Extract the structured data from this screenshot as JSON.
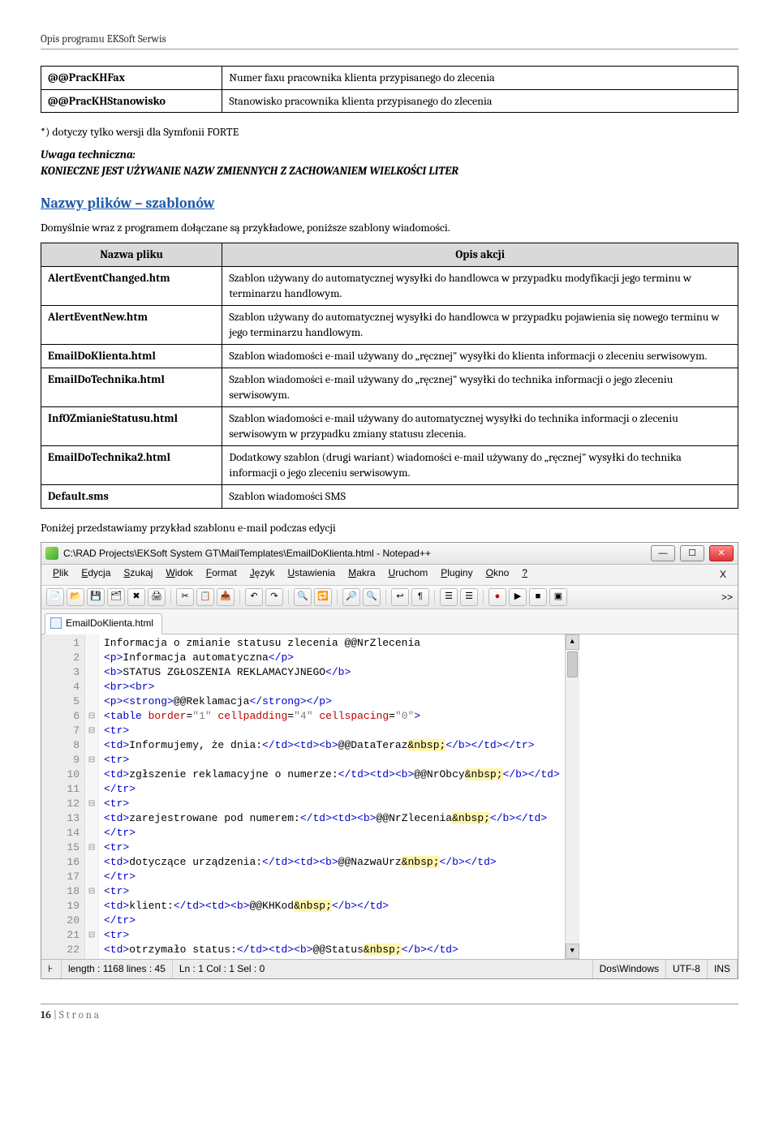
{
  "header": "Opis programu EKSoft Serwis",
  "footer_page": "16",
  "footer_label": " | S t r o n a",
  "table1": {
    "rows": [
      {
        "key": "@@PracKHFax",
        "val": "Numer faxu pracownika klienta przypisanego do zlecenia"
      },
      {
        "key": "@@PracKHStanowisko",
        "val": "Stanowisko pracownika klienta przypisanego do zlecenia"
      }
    ]
  },
  "note1": "*) dotyczy tylko wersji dla Symfonii FORTE",
  "uwaga_label": "Uwaga techniczna:",
  "uwaga_text": "KONIECZNE JEST UŻYWANIE NAZW ZMIENNYCH Z ZACHOWANIEM WIELKOŚCI LITER",
  "section_title": "Nazwy plików – szablonów",
  "intro2": "Domyślnie wraz z programem dołączane są przykładowe, poniższe szablony wiadomości.",
  "table2": {
    "header": [
      "Nazwa pliku",
      "Opis akcji"
    ],
    "rows": [
      {
        "key": "AlertEventChanged.htm",
        "val": "Szablon używany do automatycznej wysyłki do handlowca w przypadku modyfikacji jego terminu w terminarzu handlowym."
      },
      {
        "key": "AlertEventNew.htm",
        "val": "Szablon używany do automatycznej wysyłki do handlowca w przypadku pojawienia się nowego terminu w jego terminarzu handlowym."
      },
      {
        "key": "EmailDoKlienta.html",
        "val": "Szablon wiadomości e-mail używany do „ręcznej\" wysyłki do klienta informacji o zleceniu serwisowym."
      },
      {
        "key": "EmailDoTechnika.html",
        "val": "Szablon wiadomości e-mail używany do „ręcznej\" wysyłki do technika informacji o jego zleceniu serwisowym."
      },
      {
        "key": "InfOZmianieStatusu.html",
        "val": "Szablon wiadomości e-mail używany do automatycznej wysyłki do technika informacji o zleceniu serwisowym w przypadku zmiany statusu zlecenia."
      },
      {
        "key": "EmailDoTechnika2.html",
        "val": "Dodatkowy szablon (drugi wariant) wiadomości e-mail używany do „ręcznej\" wysyłki do technika informacji o jego zleceniu serwisowym."
      },
      {
        "key": "Default.sms",
        "val": "Szablon wiadomości SMS"
      }
    ]
  },
  "caption2": "Poniżej przedstawiamy przykład szablonu e-mail podczas edycji",
  "editor": {
    "title": "C:\\RAD Projects\\EKSoft System GT\\MailTemplates\\EmailDoKlienta.html - Notepad++",
    "menus": [
      "Plik",
      "Edycja",
      "Szukaj",
      "Widok",
      "Format",
      "Język",
      "Ustawienia",
      "Makra",
      "Uruchom",
      "Pluginy",
      "Okno",
      "?"
    ],
    "menu_close": "X",
    "tab": "EmailDoKlienta.html",
    "toolbar_overflow": ">>",
    "code_lines": [
      {
        "n": "1",
        "fold": "",
        "html": "Informacja o zmianie statusu zlecenia @@NrZlecenia"
      },
      {
        "n": "2",
        "fold": "",
        "html": "<span class='c-tag'>&lt;p&gt;</span>Informacja automatyczna<span class='c-tag'>&lt;/p&gt;</span>"
      },
      {
        "n": "3",
        "fold": "",
        "html": "<span class='c-tag'>&lt;b&gt;</span>STATUS ZGŁOSZENIA REKLAMACYJNEGO<span class='c-tag'>&lt;/b&gt;</span>"
      },
      {
        "n": "4",
        "fold": "",
        "html": "<span class='c-tag'>&lt;br&gt;&lt;br&gt;</span>"
      },
      {
        "n": "5",
        "fold": "",
        "html": "<span class='c-tag'>&lt;p&gt;&lt;strong&gt;</span>@@Reklamacja<span class='c-tag'>&lt;/strong&gt;&lt;/p&gt;</span>"
      },
      {
        "n": "6",
        "fold": "⊟",
        "html": "<span class='c-tag'>&lt;table</span> <span class='c-attr'>border</span>=<span class='c-str'>\"1\"</span> <span class='c-attr'>cellpadding</span>=<span class='c-str'>\"4\"</span> <span class='c-attr'>cellspacing</span>=<span class='c-str'>\"0\"</span><span class='c-tag'>&gt;</span>"
      },
      {
        "n": "7",
        "fold": "⊟",
        "html": "<span class='c-tag'>&lt;tr&gt;</span>"
      },
      {
        "n": "8",
        "fold": "",
        "html": "<span class='c-tag'>&lt;td&gt;</span>Informujemy, że dnia:<span class='c-tag'>&lt;/td&gt;&lt;td&gt;&lt;b&gt;</span>@@DataTeraz<span class='c-hl'>&amp;nbsp;</span><span class='c-tag'>&lt;/b&gt;&lt;/td&gt;&lt;/tr&gt;</span>"
      },
      {
        "n": "9",
        "fold": "⊟",
        "html": "<span class='c-tag'>&lt;tr&gt;</span>"
      },
      {
        "n": "10",
        "fold": "",
        "html": "<span class='c-tag'>&lt;td&gt;</span>zgłszenie reklamacyjne o numerze:<span class='c-tag'>&lt;/td&gt;&lt;td&gt;&lt;b&gt;</span>@@NrObcy<span class='c-hl'>&amp;nbsp;</span><span class='c-tag'>&lt;/b&gt;&lt;/td&gt;</span>"
      },
      {
        "n": "11",
        "fold": "",
        "html": "<span class='c-tag'>&lt;/tr&gt;</span>"
      },
      {
        "n": "12",
        "fold": "⊟",
        "html": "<span class='c-tag'>&lt;tr&gt;</span>"
      },
      {
        "n": "13",
        "fold": "",
        "html": "<span class='c-tag'>&lt;td&gt;</span>zarejestrowane pod numerem:<span class='c-tag'>&lt;/td&gt;&lt;td&gt;&lt;b&gt;</span>@@NrZlecenia<span class='c-hl'>&amp;nbsp;</span><span class='c-tag'>&lt;/b&gt;&lt;/td&gt;</span>"
      },
      {
        "n": "14",
        "fold": "",
        "html": "<span class='c-tag'>&lt;/tr&gt;</span>"
      },
      {
        "n": "15",
        "fold": "⊟",
        "html": "<span class='c-tag'>&lt;tr&gt;</span>"
      },
      {
        "n": "16",
        "fold": "",
        "html": "<span class='c-tag'>&lt;td&gt;</span>dotyczące urządzenia:<span class='c-tag'>&lt;/td&gt;&lt;td&gt;&lt;b&gt;</span>@@NazwaUrz<span class='c-hl'>&amp;nbsp;</span><span class='c-tag'>&lt;/b&gt;&lt;/td&gt;</span>"
      },
      {
        "n": "17",
        "fold": "",
        "html": "<span class='c-tag'>&lt;/tr&gt;</span>"
      },
      {
        "n": "18",
        "fold": "⊟",
        "html": "<span class='c-tag'>&lt;tr&gt;</span>"
      },
      {
        "n": "19",
        "fold": "",
        "html": "<span class='c-tag'>&lt;td&gt;</span>klient:<span class='c-tag'>&lt;/td&gt;&lt;td&gt;&lt;b&gt;</span>@@KHKod<span class='c-hl'>&amp;nbsp;</span><span class='c-tag'>&lt;/b&gt;&lt;/td&gt;</span>"
      },
      {
        "n": "20",
        "fold": "",
        "html": "<span class='c-tag'>&lt;/tr&gt;</span>"
      },
      {
        "n": "21",
        "fold": "⊟",
        "html": "<span class='c-tag'>&lt;tr&gt;</span>"
      },
      {
        "n": "22",
        "fold": "",
        "html": "<span class='c-tag'>&lt;td&gt;</span>otrzymało status:<span class='c-tag'>&lt;/td&gt;&lt;td&gt;&lt;b&gt;</span>@@Status<span class='c-hl'>&amp;nbsp;</span><span class='c-tag'>&lt;/b&gt;&lt;/td&gt;</span>"
      }
    ],
    "status": {
      "length": "length : 1168    lines : 45",
      "pos": "Ln : 1    Col : 1    Sel : 0",
      "eol": "Dos\\Windows",
      "enc": "UTF-8",
      "mode": "INS"
    }
  }
}
